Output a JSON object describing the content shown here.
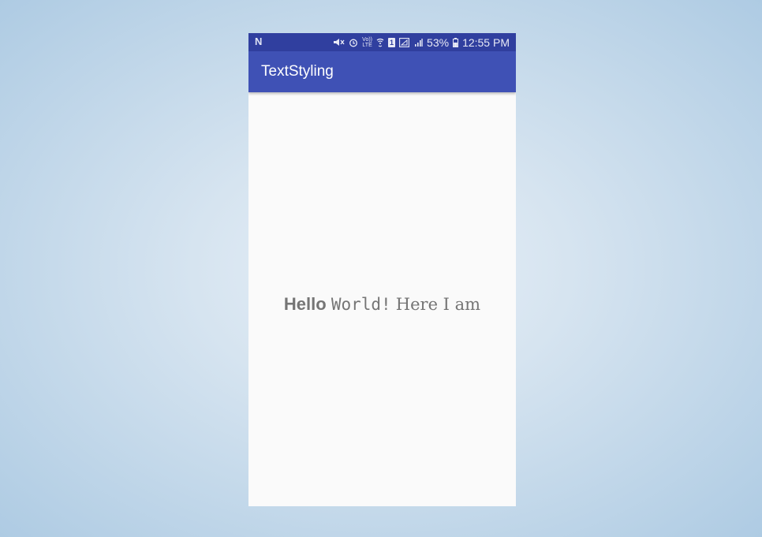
{
  "status_bar": {
    "carrier_icon": "N",
    "icons": [
      "mute-icon",
      "alarm-icon",
      "volte-icon",
      "wifi-icon",
      "sim1-icon",
      "no-signal-icon",
      "signal-icon",
      "battery-icon"
    ],
    "battery": "53%",
    "time": "12:55 PM",
    "volte_top": "Vo))",
    "volte_bottom": "LTE",
    "sim": "1"
  },
  "app_bar": {
    "title": "TextStyling"
  },
  "content": {
    "hello": "Hello",
    "world": "World!",
    "rest": "Here I am"
  },
  "colors": {
    "status_bar": "#303f9f",
    "app_bar": "#3f51b5",
    "text": "#757575",
    "background": "#fafafa"
  }
}
